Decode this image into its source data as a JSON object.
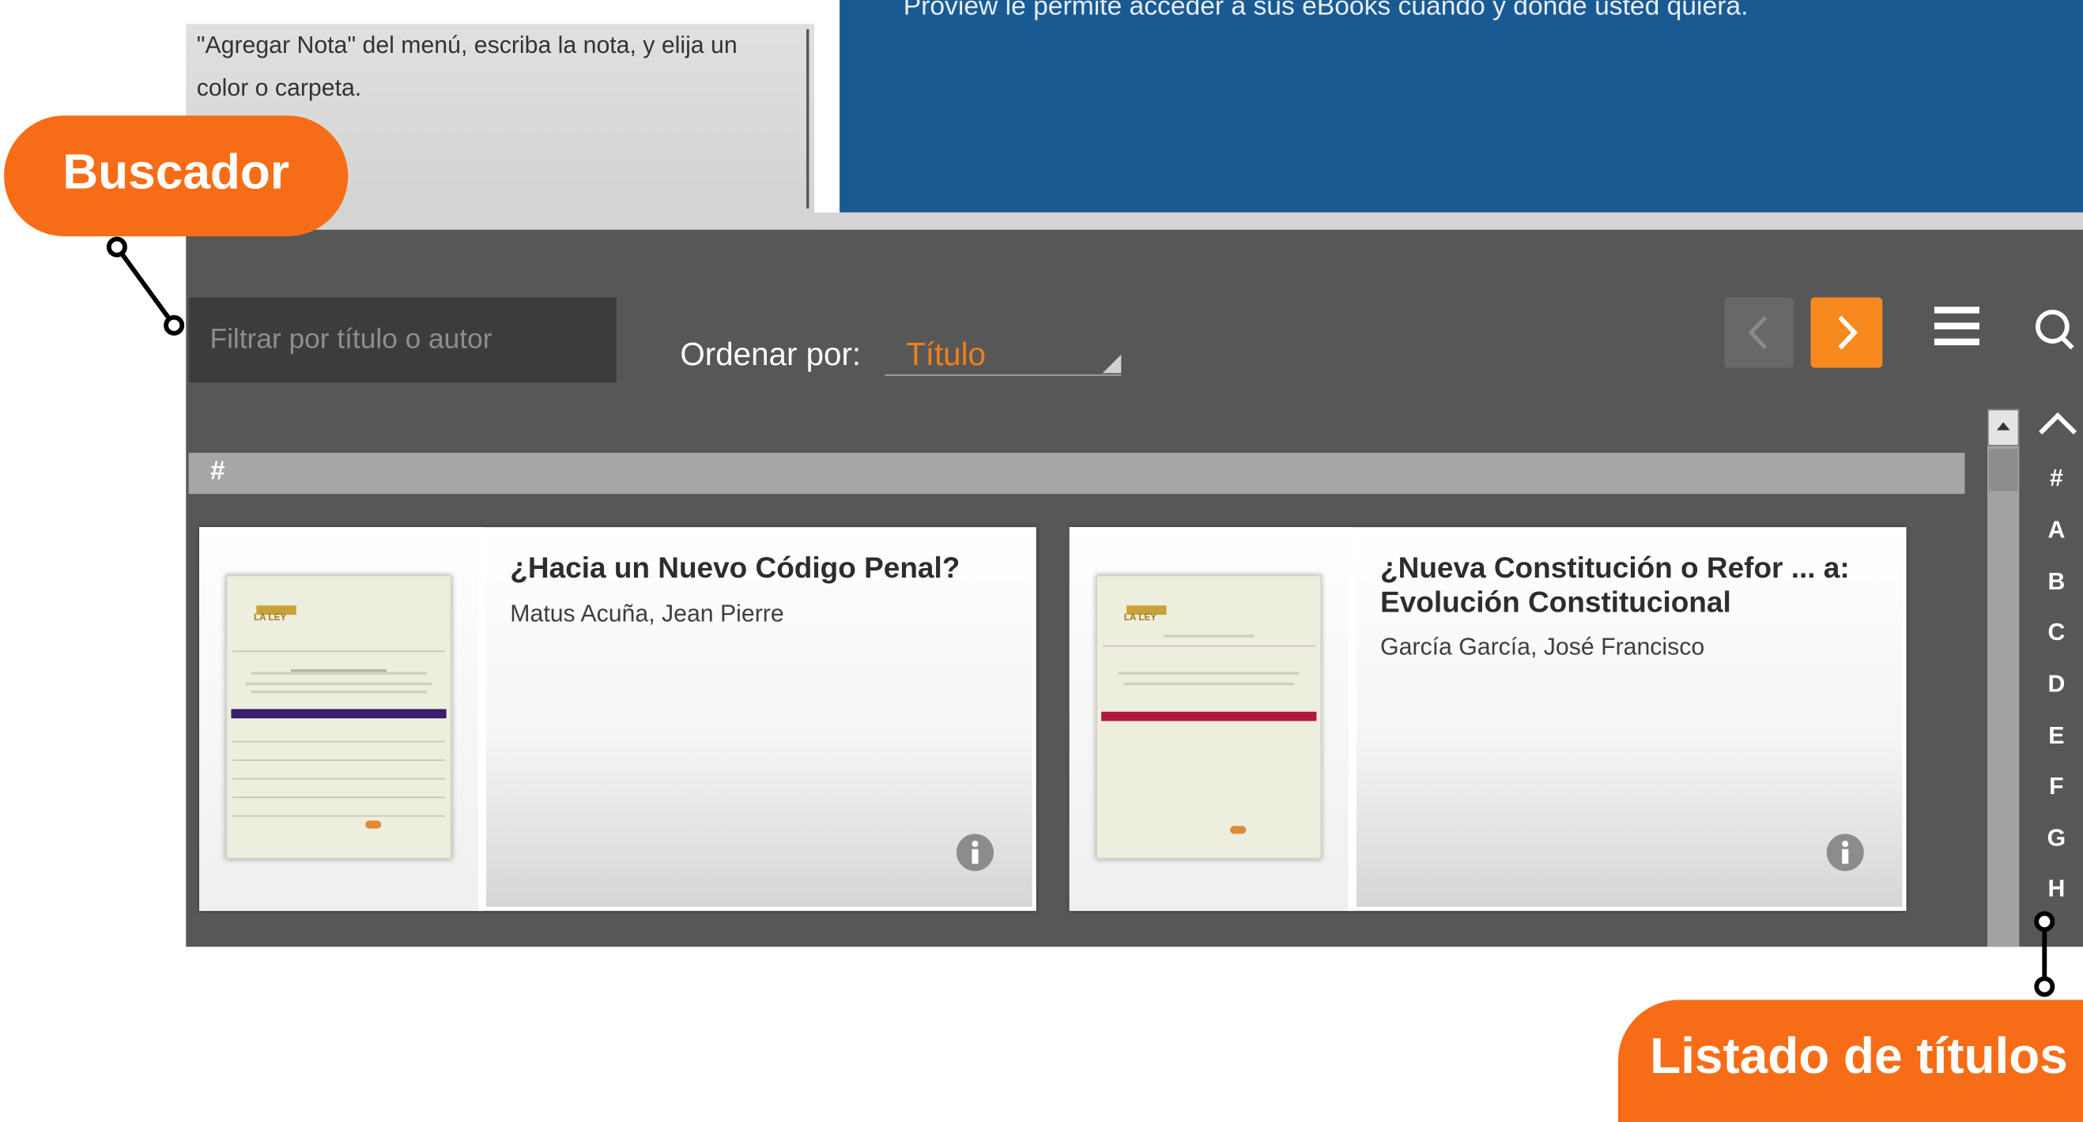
{
  "top": {
    "tip_text": "\"Agregar Nota\" del menú, escriba la nota, y elija un color o carpeta.",
    "banner_text": "Proview le permite acceder a sus eBooks cuando y donde usted quiera."
  },
  "toolbar": {
    "search_placeholder": "Filtrar por título o autor",
    "sort_label": "Ordenar por:",
    "sort_value": "Título"
  },
  "group": {
    "label": "#"
  },
  "books": [
    {
      "title": "¿Hacia un Nuevo Código Penal?",
      "author": "Matus Acuña, Jean Pierre",
      "cover_publisher": "LA LEY",
      "cover_band_color": "#3b1e6e"
    },
    {
      "title": "¿Nueva Constitución o Refor ... a: Evolución Constitucional",
      "author": "García García, José Francisco",
      "cover_publisher": "LA LEY",
      "cover_band_color": "#b01840"
    }
  ],
  "alphabet": [
    "#",
    "A",
    "B",
    "C",
    "D",
    "E",
    "F",
    "G",
    "H"
  ],
  "callouts": {
    "buscador": "Buscador",
    "listado": "Listado de títulos"
  },
  "colors": {
    "accent": "#f76d17",
    "next_button": "#f7891f",
    "banner_blue": "#1a5a93",
    "app_background": "#575757"
  },
  "icons": {
    "prev": "chevron-left-icon",
    "next": "chevron-right-icon",
    "list_view": "hamburger-list-icon",
    "search": "search-icon",
    "info": "info-circle-icon",
    "alpha_up": "chevron-up-icon"
  }
}
